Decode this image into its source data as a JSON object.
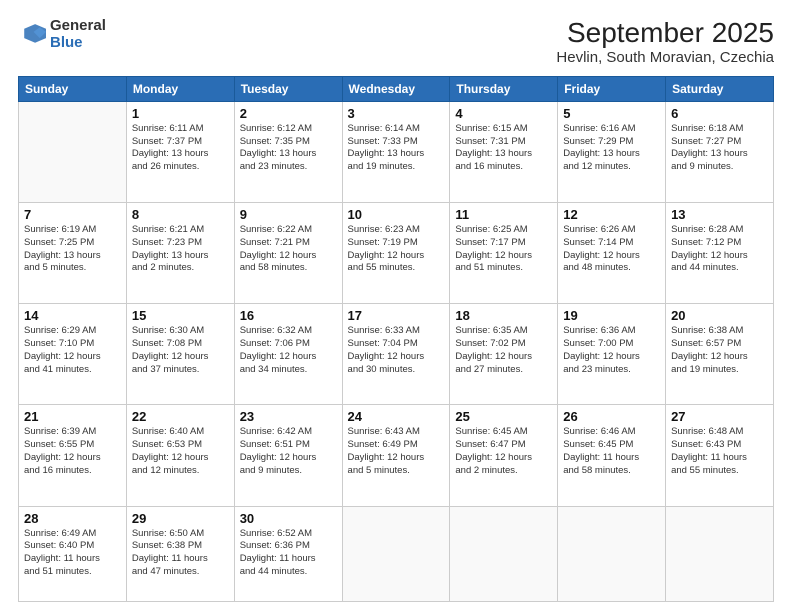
{
  "header": {
    "logo_general": "General",
    "logo_blue": "Blue",
    "title": "September 2025",
    "subtitle": "Hevlin, South Moravian, Czechia"
  },
  "days_of_week": [
    "Sunday",
    "Monday",
    "Tuesday",
    "Wednesday",
    "Thursday",
    "Friday",
    "Saturday"
  ],
  "weeks": [
    [
      {
        "day": "",
        "info": ""
      },
      {
        "day": "1",
        "info": "Sunrise: 6:11 AM\nSunset: 7:37 PM\nDaylight: 13 hours\nand 26 minutes."
      },
      {
        "day": "2",
        "info": "Sunrise: 6:12 AM\nSunset: 7:35 PM\nDaylight: 13 hours\nand 23 minutes."
      },
      {
        "day": "3",
        "info": "Sunrise: 6:14 AM\nSunset: 7:33 PM\nDaylight: 13 hours\nand 19 minutes."
      },
      {
        "day": "4",
        "info": "Sunrise: 6:15 AM\nSunset: 7:31 PM\nDaylight: 13 hours\nand 16 minutes."
      },
      {
        "day": "5",
        "info": "Sunrise: 6:16 AM\nSunset: 7:29 PM\nDaylight: 13 hours\nand 12 minutes."
      },
      {
        "day": "6",
        "info": "Sunrise: 6:18 AM\nSunset: 7:27 PM\nDaylight: 13 hours\nand 9 minutes."
      }
    ],
    [
      {
        "day": "7",
        "info": "Sunrise: 6:19 AM\nSunset: 7:25 PM\nDaylight: 13 hours\nand 5 minutes."
      },
      {
        "day": "8",
        "info": "Sunrise: 6:21 AM\nSunset: 7:23 PM\nDaylight: 13 hours\nand 2 minutes."
      },
      {
        "day": "9",
        "info": "Sunrise: 6:22 AM\nSunset: 7:21 PM\nDaylight: 12 hours\nand 58 minutes."
      },
      {
        "day": "10",
        "info": "Sunrise: 6:23 AM\nSunset: 7:19 PM\nDaylight: 12 hours\nand 55 minutes."
      },
      {
        "day": "11",
        "info": "Sunrise: 6:25 AM\nSunset: 7:17 PM\nDaylight: 12 hours\nand 51 minutes."
      },
      {
        "day": "12",
        "info": "Sunrise: 6:26 AM\nSunset: 7:14 PM\nDaylight: 12 hours\nand 48 minutes."
      },
      {
        "day": "13",
        "info": "Sunrise: 6:28 AM\nSunset: 7:12 PM\nDaylight: 12 hours\nand 44 minutes."
      }
    ],
    [
      {
        "day": "14",
        "info": "Sunrise: 6:29 AM\nSunset: 7:10 PM\nDaylight: 12 hours\nand 41 minutes."
      },
      {
        "day": "15",
        "info": "Sunrise: 6:30 AM\nSunset: 7:08 PM\nDaylight: 12 hours\nand 37 minutes."
      },
      {
        "day": "16",
        "info": "Sunrise: 6:32 AM\nSunset: 7:06 PM\nDaylight: 12 hours\nand 34 minutes."
      },
      {
        "day": "17",
        "info": "Sunrise: 6:33 AM\nSunset: 7:04 PM\nDaylight: 12 hours\nand 30 minutes."
      },
      {
        "day": "18",
        "info": "Sunrise: 6:35 AM\nSunset: 7:02 PM\nDaylight: 12 hours\nand 27 minutes."
      },
      {
        "day": "19",
        "info": "Sunrise: 6:36 AM\nSunset: 7:00 PM\nDaylight: 12 hours\nand 23 minutes."
      },
      {
        "day": "20",
        "info": "Sunrise: 6:38 AM\nSunset: 6:57 PM\nDaylight: 12 hours\nand 19 minutes."
      }
    ],
    [
      {
        "day": "21",
        "info": "Sunrise: 6:39 AM\nSunset: 6:55 PM\nDaylight: 12 hours\nand 16 minutes."
      },
      {
        "day": "22",
        "info": "Sunrise: 6:40 AM\nSunset: 6:53 PM\nDaylight: 12 hours\nand 12 minutes."
      },
      {
        "day": "23",
        "info": "Sunrise: 6:42 AM\nSunset: 6:51 PM\nDaylight: 12 hours\nand 9 minutes."
      },
      {
        "day": "24",
        "info": "Sunrise: 6:43 AM\nSunset: 6:49 PM\nDaylight: 12 hours\nand 5 minutes."
      },
      {
        "day": "25",
        "info": "Sunrise: 6:45 AM\nSunset: 6:47 PM\nDaylight: 12 hours\nand 2 minutes."
      },
      {
        "day": "26",
        "info": "Sunrise: 6:46 AM\nSunset: 6:45 PM\nDaylight: 11 hours\nand 58 minutes."
      },
      {
        "day": "27",
        "info": "Sunrise: 6:48 AM\nSunset: 6:43 PM\nDaylight: 11 hours\nand 55 minutes."
      }
    ],
    [
      {
        "day": "28",
        "info": "Sunrise: 6:49 AM\nSunset: 6:40 PM\nDaylight: 11 hours\nand 51 minutes."
      },
      {
        "day": "29",
        "info": "Sunrise: 6:50 AM\nSunset: 6:38 PM\nDaylight: 11 hours\nand 47 minutes."
      },
      {
        "day": "30",
        "info": "Sunrise: 6:52 AM\nSunset: 6:36 PM\nDaylight: 11 hours\nand 44 minutes."
      },
      {
        "day": "",
        "info": ""
      },
      {
        "day": "",
        "info": ""
      },
      {
        "day": "",
        "info": ""
      },
      {
        "day": "",
        "info": ""
      }
    ]
  ]
}
